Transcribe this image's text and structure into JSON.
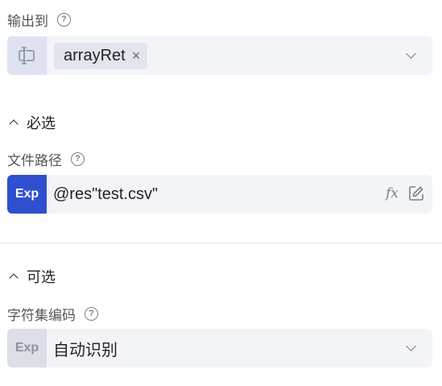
{
  "output": {
    "label": "输出到",
    "help_glyph": "?",
    "tag_value": "arrayRet",
    "tag_close_glyph": "×",
    "icon": "variable-cursor-icon"
  },
  "required_section": {
    "title": "必选",
    "file_path": {
      "label": "文件路径",
      "help_glyph": "?",
      "exp_label": "Exp",
      "value": "@res\"test.csv\"",
      "fx_label": "fx"
    }
  },
  "optional_section": {
    "title": "可选",
    "encoding": {
      "label": "字符集编码",
      "help_glyph": "?",
      "exp_label": "Exp",
      "value": "自动识别"
    }
  },
  "colors": {
    "exp_active": "#2f4fd1",
    "field_bg": "#f3f4f7"
  }
}
